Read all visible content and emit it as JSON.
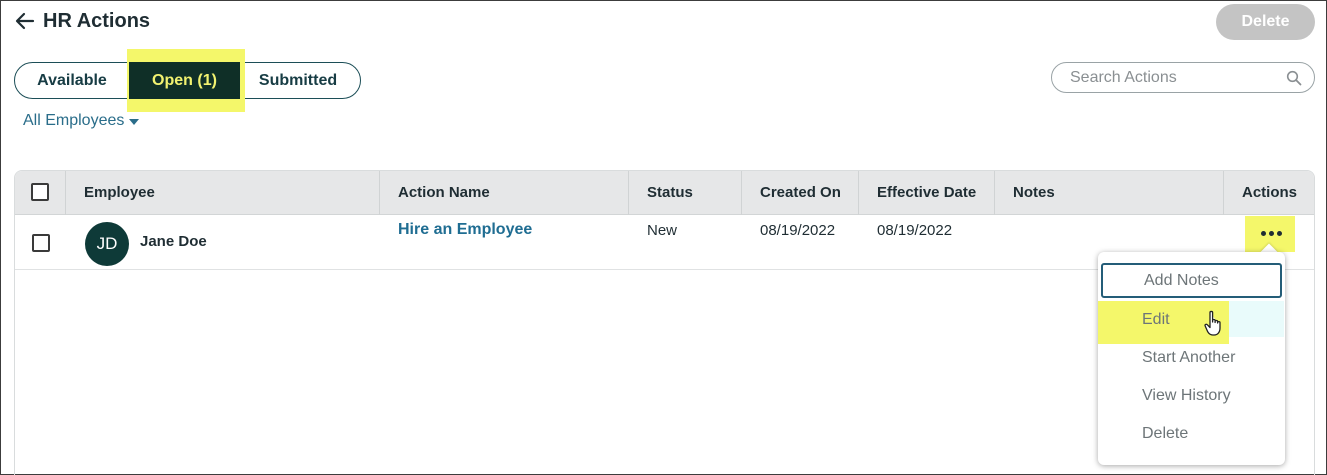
{
  "header": {
    "title": "HR Actions",
    "delete_label": "Delete"
  },
  "tabs": [
    {
      "label": "Available",
      "active": false
    },
    {
      "label": "Open (1)",
      "active": true
    },
    {
      "label": "Submitted",
      "active": false
    }
  ],
  "search": {
    "placeholder": "Search Actions",
    "value": ""
  },
  "filter": {
    "label": "All Employees"
  },
  "table": {
    "columns": [
      "Employee",
      "Action Name",
      "Status",
      "Created On",
      "Effective Date",
      "Notes",
      "Actions"
    ],
    "rows": [
      {
        "initials": "JD",
        "employee": "Jane Doe",
        "action_name": "Hire an Employee",
        "status": "New",
        "created_on": "08/19/2022",
        "effective_date": "08/19/2022",
        "notes": ""
      }
    ]
  },
  "actions_menu": {
    "items": [
      "Add Notes",
      "Edit",
      "Start Another",
      "View History",
      "Delete"
    ]
  },
  "colors": {
    "active_tab_bg": "#0f2f27",
    "active_tab_text": "#f2f270",
    "highlight": "#f4f76a",
    "link": "#1f6d92",
    "avatar_bg": "#0e3a38",
    "delete_disabled": "#c4c4c4"
  },
  "icons": {
    "back": "arrow-left-icon",
    "search": "search-icon",
    "filter_caret": "caret-down-icon",
    "row_actions": "more-horizontal-icon",
    "cursor": "hand-pointer-icon"
  }
}
